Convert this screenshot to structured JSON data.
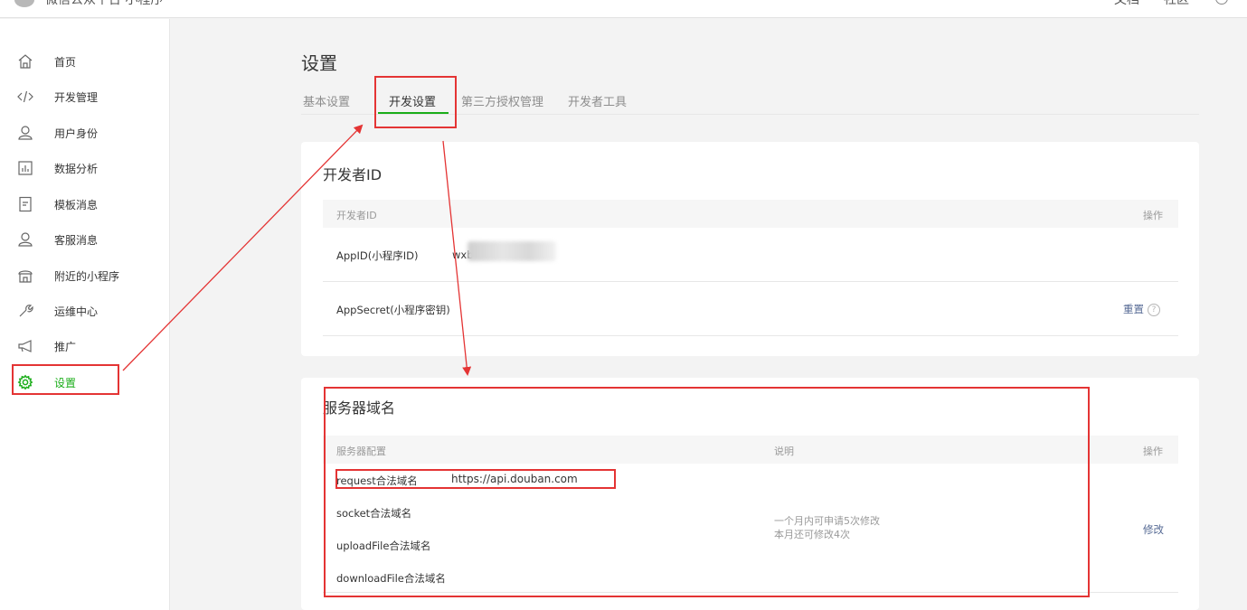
{
  "topbar": {
    "brand": "微信公众平台 小程序",
    "nav": [
      "文档",
      "社区"
    ]
  },
  "sidebar": {
    "items": [
      {
        "label": "首页",
        "icon": "home-icon"
      },
      {
        "label": "开发管理",
        "icon": "code-icon"
      },
      {
        "label": "用户身份",
        "icon": "user-icon"
      },
      {
        "label": "数据分析",
        "icon": "chart-icon"
      },
      {
        "label": "模板消息",
        "icon": "document-icon"
      },
      {
        "label": "客服消息",
        "icon": "customer-service-icon"
      },
      {
        "label": "附近的小程序",
        "icon": "store-icon"
      },
      {
        "label": "运维中心",
        "icon": "wrench-icon"
      },
      {
        "label": "推广",
        "icon": "megaphone-icon"
      },
      {
        "label": "设置",
        "icon": "gear-icon",
        "active": true
      }
    ],
    "accent_color": "#1aad19"
  },
  "page": {
    "title": "设置",
    "tabs": [
      {
        "label": "基本设置"
      },
      {
        "label": "开发设置",
        "active": true
      },
      {
        "label": "第三方授权管理"
      },
      {
        "label": "开发者工具"
      }
    ]
  },
  "developer": {
    "title": "开发者ID",
    "col_id": "开发者ID",
    "col_action": "操作",
    "appid_label": "AppID(小程序ID)",
    "appid_value": "wxb",
    "secret_label": "AppSecret(小程序密钥)",
    "reset_label": "重置",
    "help_glyph": "?"
  },
  "server": {
    "title": "服务器域名",
    "col_config": "服务器配置",
    "col_desc": "说明",
    "col_action": "操作",
    "rows": [
      {
        "label": "request合法域名",
        "value": "https://api.douban.com"
      },
      {
        "label": "socket合法域名"
      },
      {
        "label": "uploadFile合法域名"
      },
      {
        "label": "downloadFile合法域名"
      }
    ],
    "desc_line1": "一个月内可申请5次修改",
    "desc_line2": "本月还可修改4次",
    "modify_label": "修改",
    "link_color": "#576b95"
  },
  "annotation": {
    "color": "#e43434"
  }
}
